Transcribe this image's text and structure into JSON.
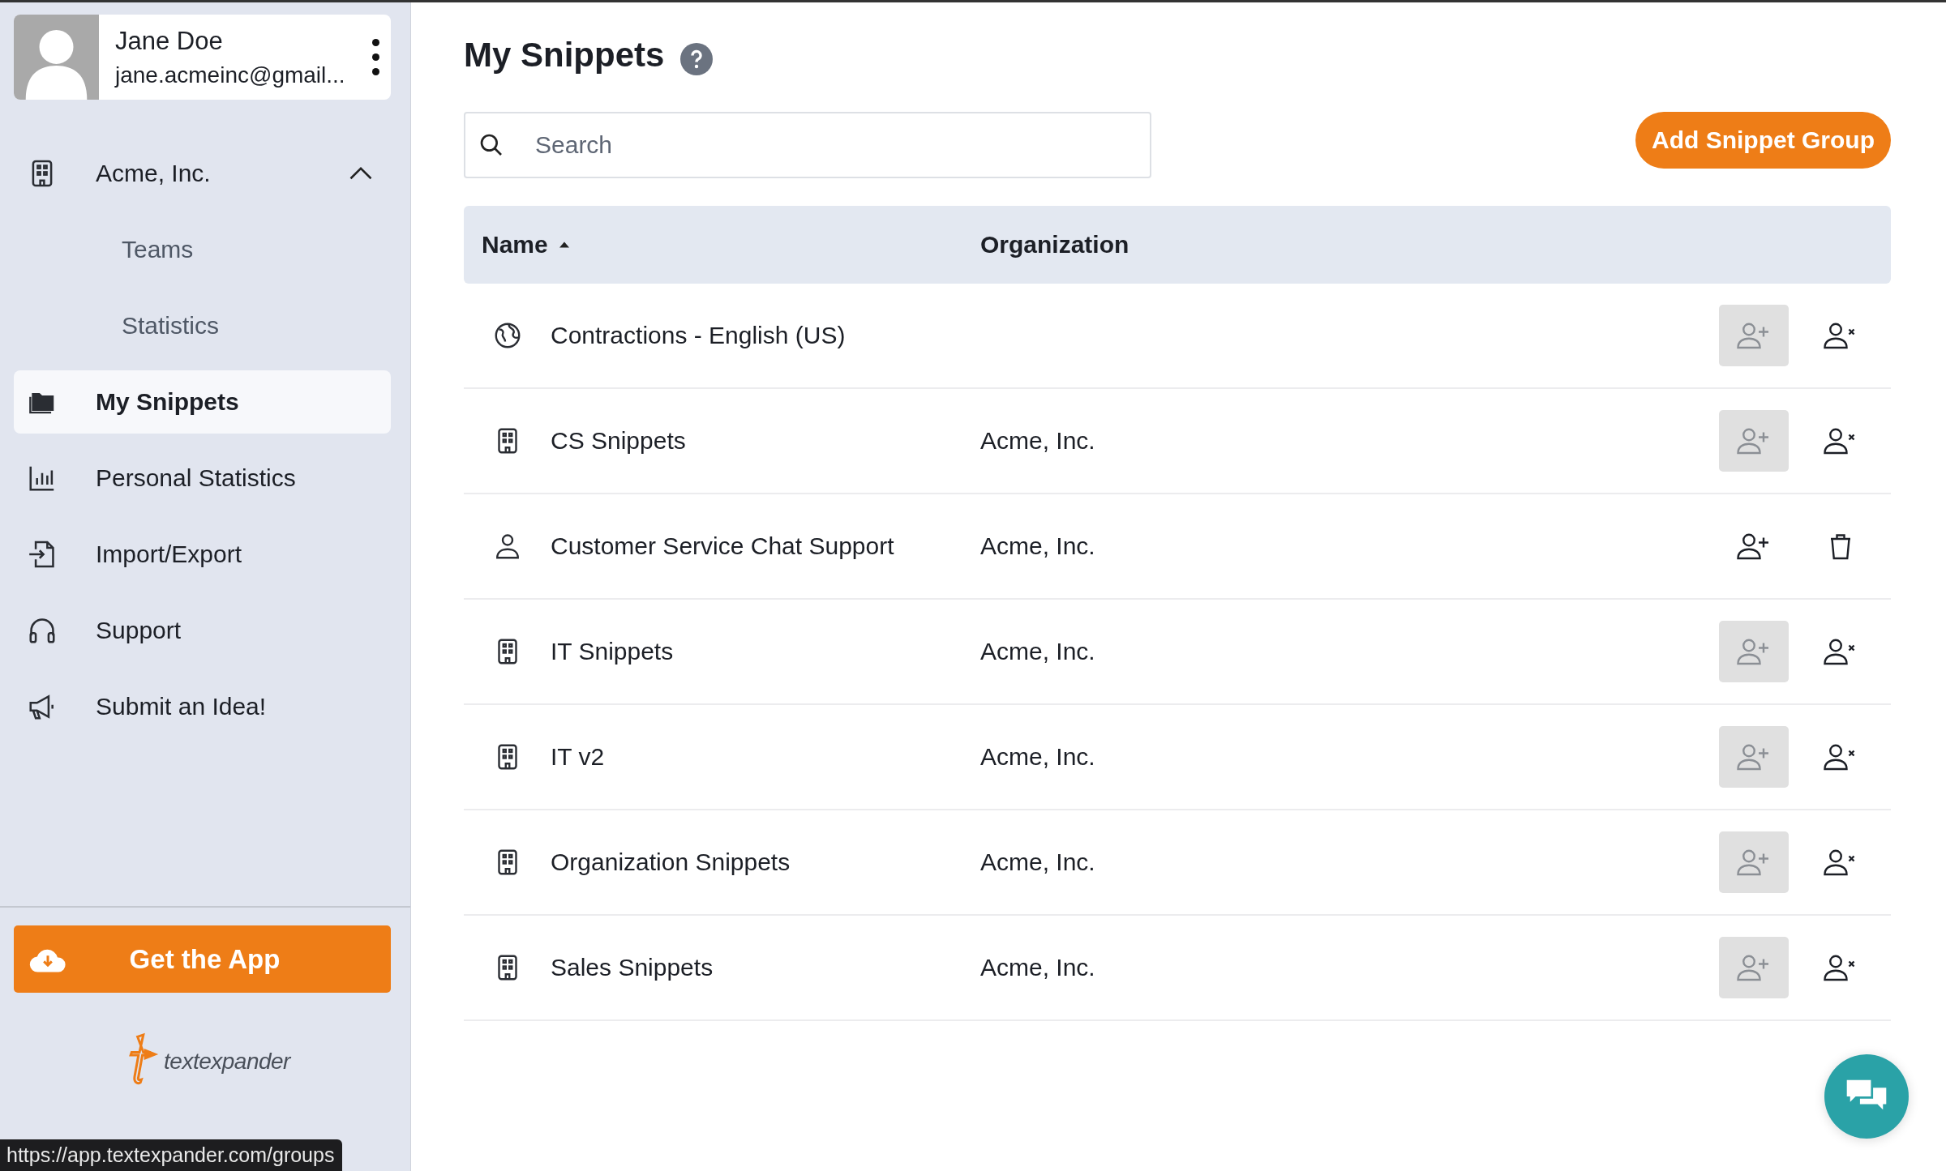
{
  "sidebar": {
    "profile": {
      "name": "Jane Doe",
      "email": "jane.acmeinc@gmail..."
    },
    "nav": [
      {
        "label": "Acme, Inc.",
        "kind": "building",
        "selected": false,
        "expanded": true,
        "children": [
          {
            "label": "Teams",
            "selected": false
          },
          {
            "label": "Statistics",
            "selected": false
          }
        ]
      },
      {
        "label": "My Snippets",
        "kind": "folder",
        "selected": true
      },
      {
        "label": "Personal Statistics",
        "kind": "chart",
        "selected": false
      },
      {
        "label": "Import/Export",
        "kind": "import",
        "selected": false
      },
      {
        "label": "Support",
        "kind": "headset",
        "selected": false
      },
      {
        "label": "Submit an Idea!",
        "kind": "megaphone",
        "selected": false
      }
    ],
    "get_app_button": "Get the App",
    "logo_text": "textexpander"
  },
  "page": {
    "title": "My Snippets",
    "search": {
      "placeholder": "Search"
    },
    "add_button": "Add Snippet Group"
  },
  "table": {
    "columns": [
      {
        "label": "Name",
        "sorted": true
      },
      {
        "label": "Organization",
        "sorted": false
      }
    ],
    "rows": [
      {
        "kind": "globe",
        "name": "Contractions - English (US)",
        "add_disabled": true,
        "deletable": false
      },
      {
        "kind": "building",
        "name": "CS Snippets",
        "organization": "Acme, Inc.",
        "add_disabled": true,
        "deletable": false
      },
      {
        "kind": "person",
        "name": "Customer Service Chat Support",
        "organization": "Acme, Inc.",
        "add_disabled": false,
        "deletable": true
      },
      {
        "kind": "building",
        "name": "IT Snippets",
        "organization": "Acme, Inc.",
        "add_disabled": true,
        "deletable": false
      },
      {
        "kind": "building",
        "name": "IT v2",
        "organization": "Acme, Inc.",
        "add_disabled": true,
        "deletable": false
      },
      {
        "kind": "building",
        "name": "Organization Snippets",
        "organization": "Acme, Inc.",
        "add_disabled": true,
        "deletable": false
      },
      {
        "kind": "building",
        "name": "Sales Snippets",
        "organization": "Acme, Inc.",
        "add_disabled": true,
        "deletable": false
      }
    ]
  },
  "status_url": "https://app.textexpander.com/groups"
}
